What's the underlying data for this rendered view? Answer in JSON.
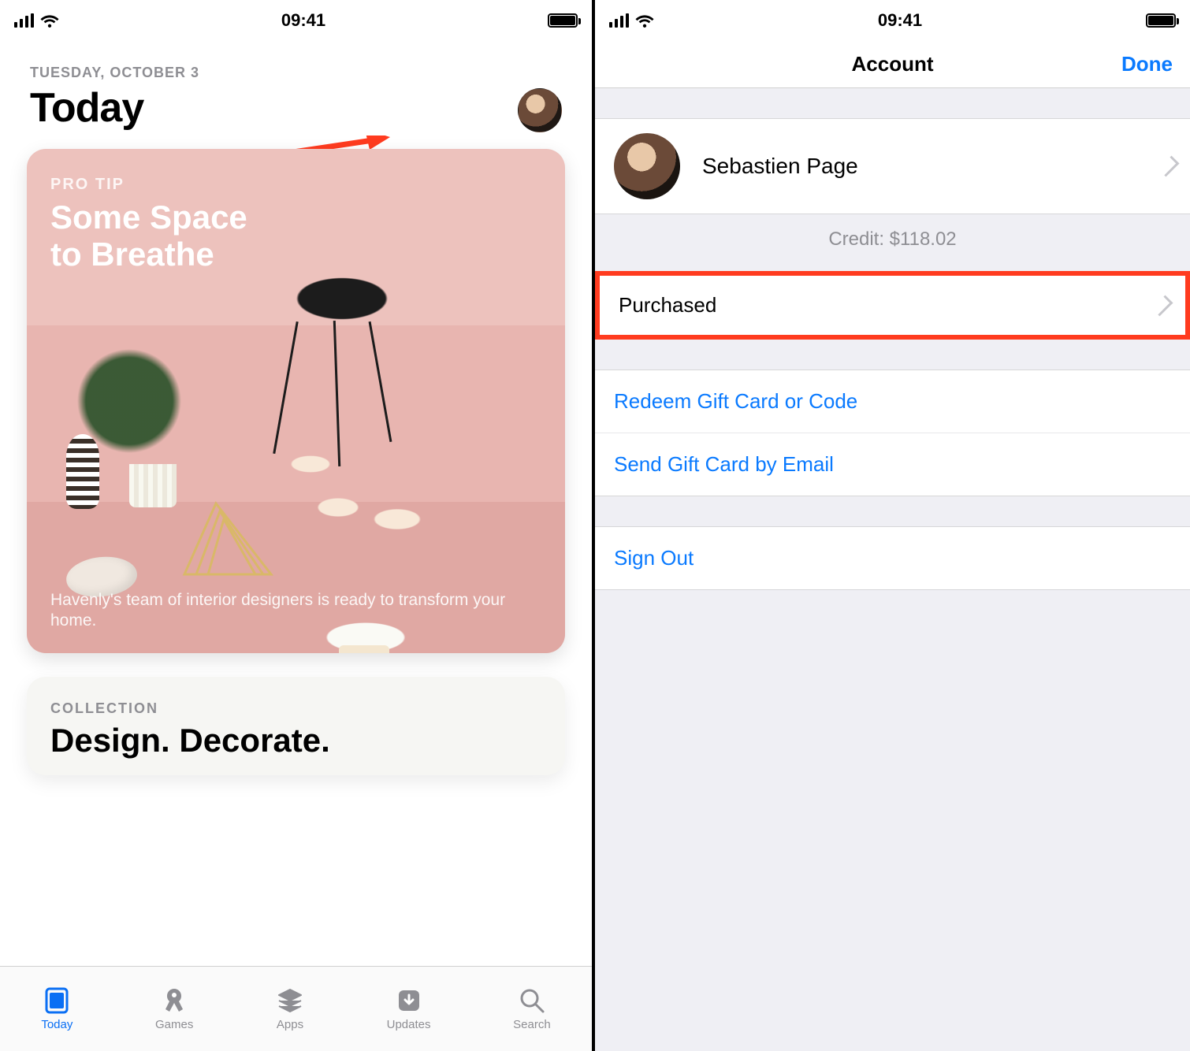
{
  "status": {
    "time": "09:41"
  },
  "today": {
    "date_label": "TUESDAY, OCTOBER 3",
    "title": "Today",
    "card1": {
      "tag": "PRO TIP",
      "title_line1": "Some Space",
      "title_line2": "to Breathe",
      "caption": "Havenly's team of interior designers is ready to transform your home."
    },
    "card2": {
      "tag": "COLLECTION",
      "title": "Design. Decorate."
    },
    "tabs": {
      "today": "Today",
      "games": "Games",
      "apps": "Apps",
      "updates": "Updates",
      "search": "Search"
    }
  },
  "account": {
    "nav_title": "Account",
    "done": "Done",
    "profile_name": "Sebastien Page",
    "credit": "Credit: $118.02",
    "purchased": "Purchased",
    "redeem": "Redeem Gift Card or Code",
    "send_gift": "Send Gift Card by Email",
    "sign_out": "Sign Out"
  }
}
